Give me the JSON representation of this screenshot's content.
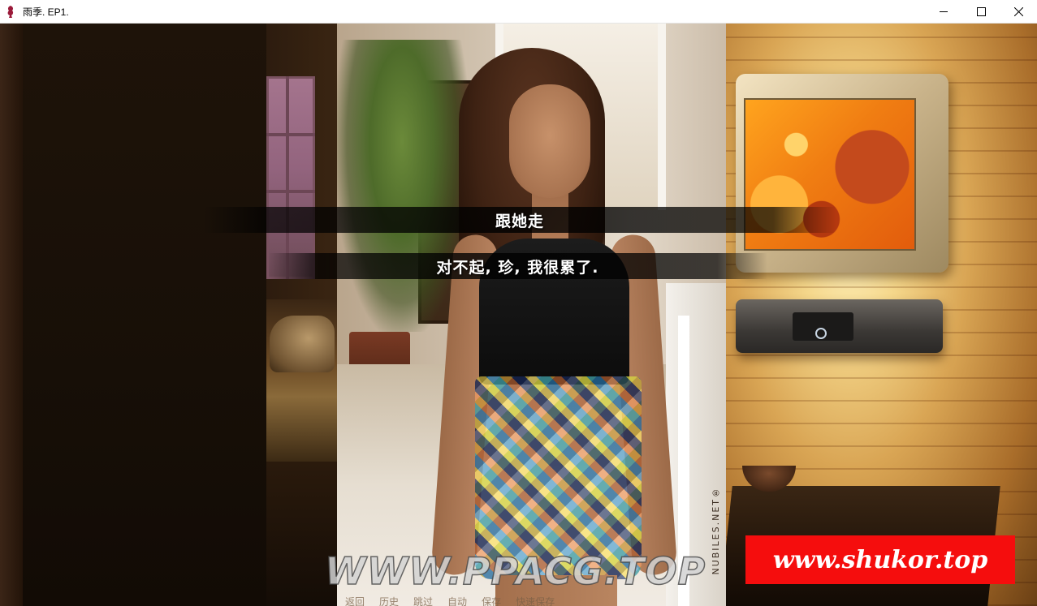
{
  "window": {
    "title": "雨季. EP1.",
    "controls": {
      "minimize_icon": "minimize-icon",
      "maximize_icon": "maximize-icon",
      "close_icon": "close-icon"
    }
  },
  "game": {
    "choices": [
      {
        "label": "跟她走"
      },
      {
        "label": "对不起, 珍, 我很累了."
      }
    ],
    "quick_menu": [
      "返回",
      "历史",
      "跳过",
      "自动",
      "保存",
      "快速保存"
    ],
    "photo_credit": "NUBILES.NET®"
  },
  "watermarks": {
    "left": "WWW.PPACG.TOP",
    "right": "www.shukor.top",
    "right_bg": "#f50d0d"
  }
}
